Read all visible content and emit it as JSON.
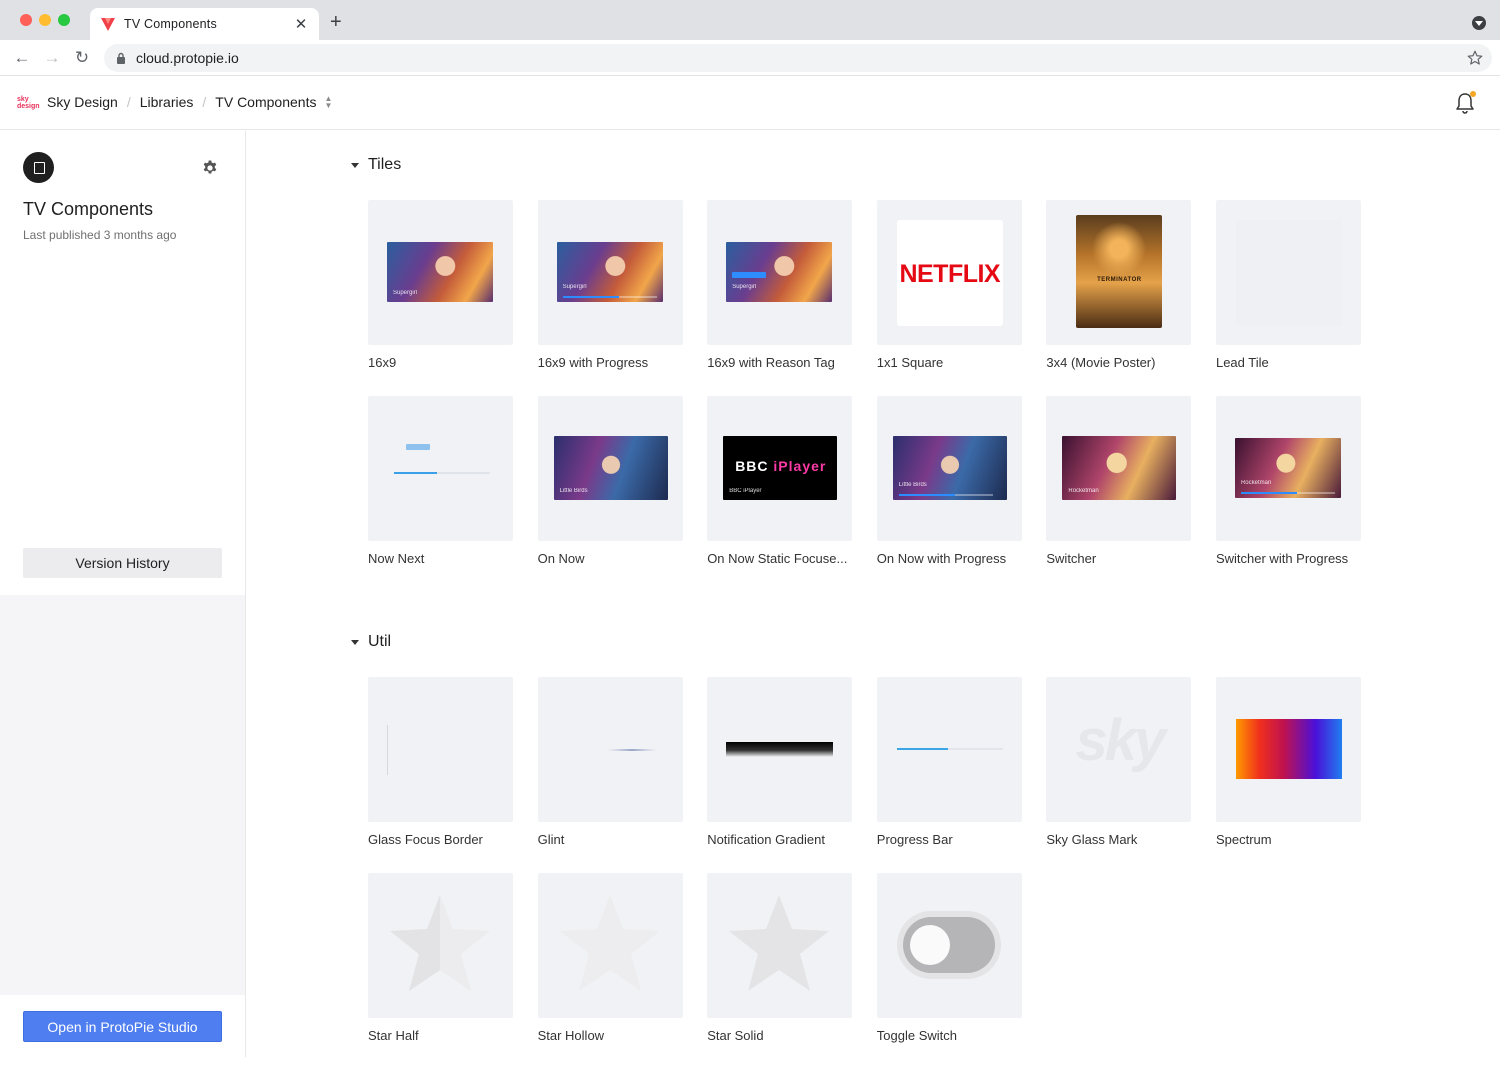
{
  "browser": {
    "tab_title": "TV Components",
    "tab_close": "✕",
    "new_tab": "+",
    "url": "cloud.protopie.io"
  },
  "header": {
    "logo_text": "sky design",
    "breadcrumbs": [
      "Sky Design",
      "Libraries",
      "TV Components"
    ],
    "separator": "/",
    "accent_color": "#e8315a",
    "notification_dot_color": "#f5a623"
  },
  "sidebar": {
    "library_title": "TV Components",
    "last_published": "Last published 3 months ago",
    "version_history_label": "Version History",
    "open_studio_label": "Open in ProtoPie Studio",
    "primary_button_color": "#4f7ef0"
  },
  "sections": [
    {
      "title": "Tiles",
      "items": [
        {
          "label": "16x9",
          "thumb": "supergirl-16x9",
          "overlay": "Supergirl"
        },
        {
          "label": "16x9 with Progress",
          "thumb": "supergirl-progress",
          "overlay": "Supergirl"
        },
        {
          "label": "16x9 with Reason Tag",
          "thumb": "supergirl-reason",
          "overlay": "Supergirl"
        },
        {
          "label": "1x1 Square",
          "thumb": "netflix-logo",
          "overlay": "NETFLIX"
        },
        {
          "label": "3x4 (Movie Poster)",
          "thumb": "terminator-poster",
          "overlay": "TERMINATOR"
        },
        {
          "label": "Lead Tile",
          "thumb": "blank"
        },
        {
          "label": "Now Next",
          "thumb": "now-next-bar"
        },
        {
          "label": "On Now",
          "thumb": "harley-quinn",
          "overlay": "Little Birds"
        },
        {
          "label": "On Now Static Focuse...",
          "thumb": "bbc-iplayer",
          "overlay": "BBC iPlayer"
        },
        {
          "label": "On Now with Progress",
          "thumb": "harley-quinn-progress",
          "overlay": "Little Birds"
        },
        {
          "label": "Switcher",
          "thumb": "rocketman",
          "overlay": "Rocketman"
        },
        {
          "label": "Switcher with Progress",
          "thumb": "rocketman-progress",
          "overlay": "Rocketman"
        }
      ]
    },
    {
      "title": "Util",
      "items": [
        {
          "label": "Glass Focus Border",
          "thumb": "focus-border"
        },
        {
          "label": "Glint",
          "thumb": "glint"
        },
        {
          "label": "Notification Gradient",
          "thumb": "black-gradient"
        },
        {
          "label": "Progress Bar",
          "thumb": "progress-line"
        },
        {
          "label": "Sky Glass Mark",
          "thumb": "sky-watermark",
          "overlay": "sky"
        },
        {
          "label": "Spectrum",
          "thumb": "spectrum-gradient"
        },
        {
          "label": "Star Half",
          "thumb": "star-half-icon"
        },
        {
          "label": "Star Hollow",
          "thumb": "star-hollow-icon"
        },
        {
          "label": "Star Solid",
          "thumb": "star-solid-icon"
        },
        {
          "label": "Toggle Switch",
          "thumb": "toggle-switch"
        }
      ]
    }
  ]
}
